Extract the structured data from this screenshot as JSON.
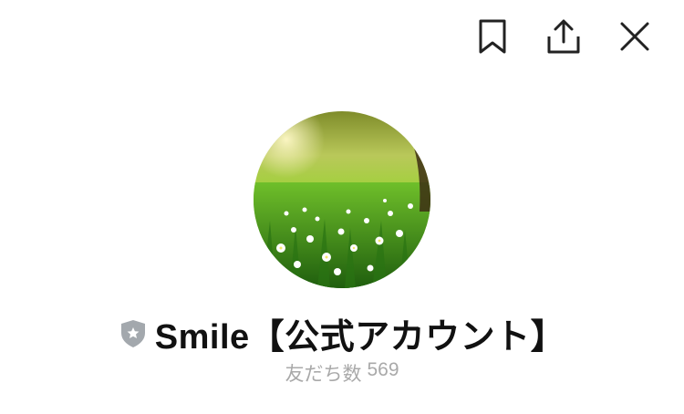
{
  "toolbar": {
    "icons": [
      "bookmark-icon",
      "share-icon",
      "close-icon"
    ]
  },
  "profile": {
    "avatar_icon": "meadow-photo",
    "badge_icon": "official-shield-star-icon",
    "name": "Smile【公式アカウント】",
    "friends_label": "友だち数",
    "friends_count": "569"
  },
  "colors": {
    "icon": "#222222",
    "badge": "#a3a8ad",
    "name": "#111111",
    "muted": "#a9a9a9"
  }
}
